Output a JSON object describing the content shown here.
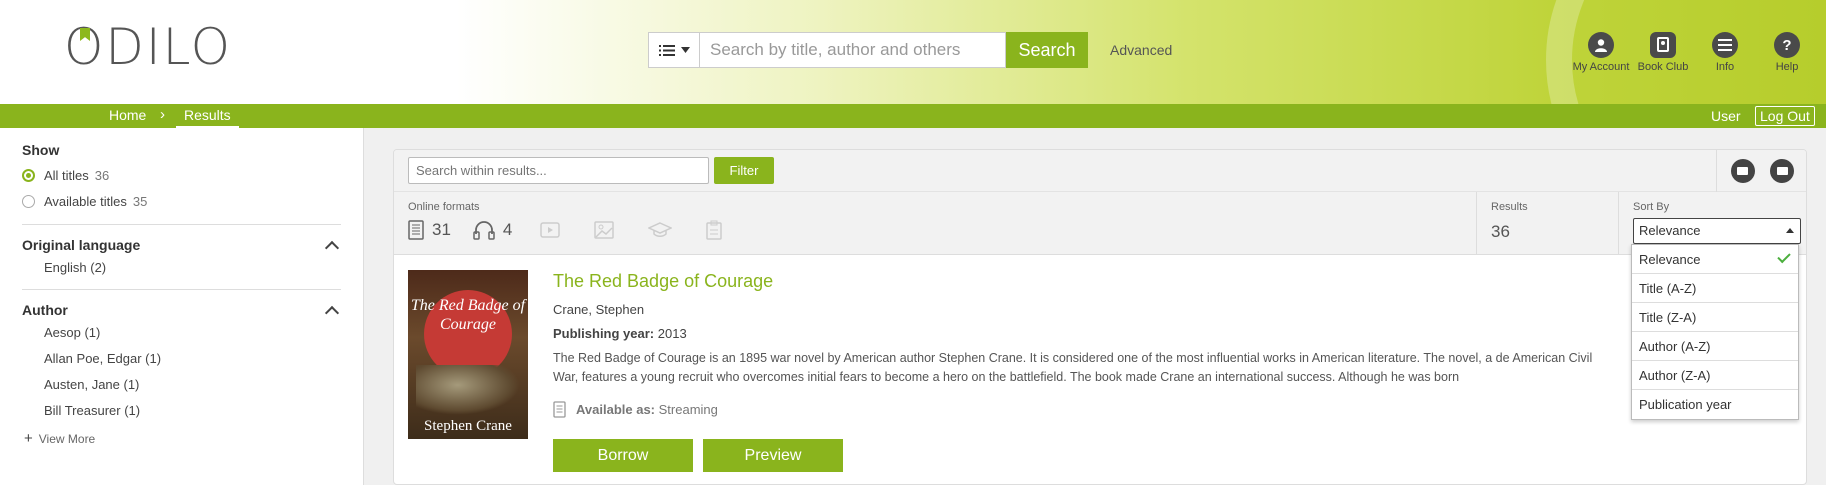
{
  "header": {
    "logo": "ODILO",
    "search": {
      "placeholder": "Search by title, author and others",
      "button_label": "Search",
      "advanced_label": "Advanced"
    },
    "nav_icons": [
      {
        "label": "My Account",
        "icon": "user-icon"
      },
      {
        "label": "Book Club",
        "icon": "book-club-icon"
      },
      {
        "label": "Info",
        "icon": "menu-icon"
      },
      {
        "label": "Help",
        "icon": "help-icon"
      }
    ]
  },
  "breadcrumb": {
    "home": "Home",
    "current": "Results",
    "user": "User",
    "logout": "Log Out"
  },
  "sidebar": {
    "show": {
      "title": "Show",
      "options": [
        {
          "label": "All titles",
          "count": "36",
          "selected": true
        },
        {
          "label": "Available titles",
          "count": "35",
          "selected": false
        }
      ]
    },
    "language": {
      "title": "Original language",
      "items": [
        "English (2)"
      ]
    },
    "author": {
      "title": "Author",
      "items": [
        "Aesop (1)",
        "Allan Poe, Edgar (1)",
        "Austen, Jane (1)",
        "Bill Treasurer (1)"
      ],
      "view_more": "View More"
    }
  },
  "toolbar": {
    "within_placeholder": "Search within results...",
    "filter_label": "Filter"
  },
  "formats": {
    "label": "Online formats",
    "items": [
      {
        "icon": "ebook-icon",
        "count": "31"
      },
      {
        "icon": "audiobook-icon",
        "count": "4"
      },
      {
        "icon": "video-icon",
        "count": ""
      },
      {
        "icon": "image-icon",
        "count": ""
      },
      {
        "icon": "course-icon",
        "count": ""
      },
      {
        "icon": "document-icon",
        "count": ""
      }
    ]
  },
  "results": {
    "label": "Results",
    "count": "36"
  },
  "sort": {
    "label": "Sort By",
    "selected": "Relevance",
    "options": [
      "Relevance",
      "Title (A-Z)",
      "Title (Z-A)",
      "Author (A-Z)",
      "Author (Z-A)",
      "Publication year"
    ]
  },
  "book": {
    "title": "The Red Badge of Courage",
    "author": "Crane, Stephen",
    "year_label": "Publishing year:",
    "year": "2013",
    "description": "The Red Badge of Courage is an 1895 war novel by American author Stephen Crane. It is considered one of the most influential works in American literature. The novel, a de American Civil War, features a young recruit who overcomes initial fears to become a hero on the battlefield. The book made Crane an international success. Although he was born",
    "cover_title": "The Red Badge of Courage",
    "cover_author": "Stephen Crane",
    "available_label": "Available as:",
    "available_value": "Streaming",
    "borrow_label": "Borrow",
    "preview_label": "Preview"
  },
  "colors": {
    "brand_green": "#8ab41d",
    "check_green": "#4caf3e"
  }
}
